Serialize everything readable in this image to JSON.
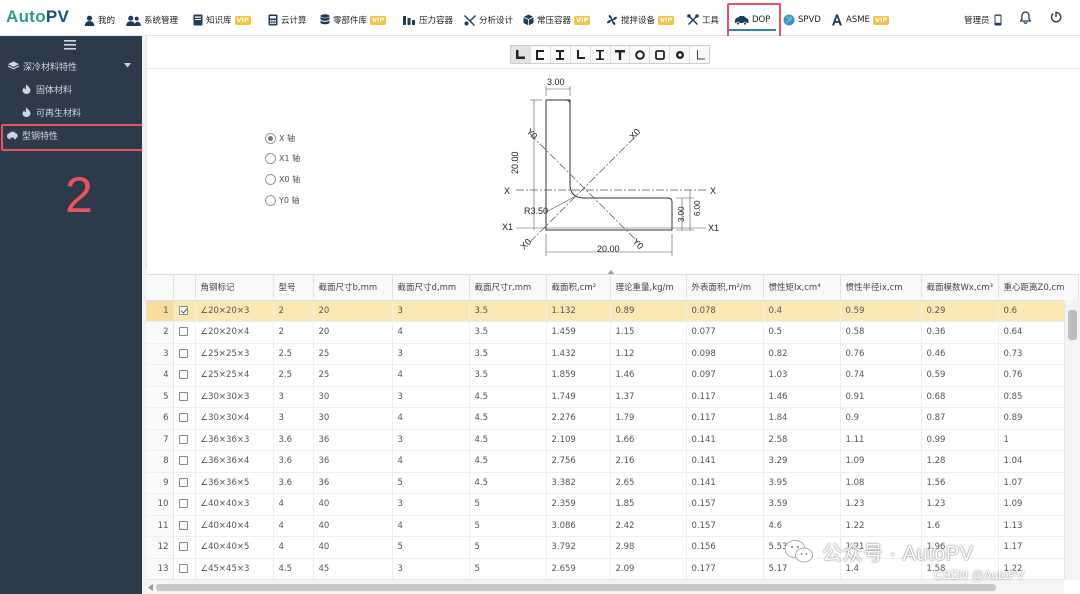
{
  "app": {
    "logo_a": "Auto",
    "logo_b": "PV"
  },
  "nav": [
    {
      "label": "我的",
      "icon": "user-icon",
      "vip": ""
    },
    {
      "label": "系统管理",
      "icon": "users-icon",
      "vip": ""
    },
    {
      "label": "知识库",
      "icon": "book-icon",
      "vip": "VIP"
    },
    {
      "label": "云计算",
      "icon": "calculator-icon",
      "vip": ""
    },
    {
      "label": "零部件库",
      "icon": "database-icon",
      "vip": "VIP"
    },
    {
      "label": "压力容器",
      "icon": "vessel-icon",
      "vip": ""
    },
    {
      "label": "分析设计",
      "icon": "wrench-screwdriver-icon",
      "vip": ""
    },
    {
      "label": "常压容器",
      "icon": "cube-icon",
      "vip": "VIP"
    },
    {
      "label": "搅拌设备",
      "icon": "fan-icon",
      "vip": "VIP"
    },
    {
      "label": "工具",
      "icon": "tools-icon",
      "vip": ""
    },
    {
      "label": "DOP",
      "icon": "car-icon",
      "vip": ""
    },
    {
      "label": "SPVD",
      "icon": "globe-icon",
      "vip": ""
    },
    {
      "label": "ASME",
      "icon": "letter-a-icon",
      "vip": "VIP"
    }
  ],
  "user": {
    "label": "管理员"
  },
  "sidebar": {
    "group": "深冷材料特性",
    "items": [
      "固体材料",
      "可再生材料"
    ],
    "section": "型钢特性"
  },
  "annotations": {
    "one": "1",
    "two": "2"
  },
  "toolbar": {
    "shapes": [
      "L",
      "C",
      "I",
      "L",
      "I",
      "T",
      "O",
      "O",
      "O",
      "L"
    ]
  },
  "axis_options": [
    "X 轴",
    "X1 轴",
    "X0 轴",
    "Y0 轴"
  ],
  "drawing": {
    "dim_t": "3.00",
    "dim_h": "20.00",
    "dim_r": "R3.50",
    "dim_b": "20.00",
    "dim_t2": "3.00",
    "dim_z": "6.00",
    "x": "X",
    "x1": "X1",
    "x0": "X0",
    "y0": "Y0"
  },
  "table": {
    "headers": [
      "角钢标记",
      "型号",
      "截面尺寸b,mm",
      "截面尺寸d,mm",
      "截面尺寸r,mm",
      "截面积,cm²",
      "理论重量,kg/m",
      "外表面积,m²/m",
      "惯性矩Ix,cm⁴",
      "惯性半径ix,cm",
      "截面模数Wx,cm³",
      "重心距离Z0,cm"
    ],
    "rows": [
      [
        "∠20×20×3",
        "2",
        "20",
        "3",
        "3.5",
        "1.132",
        "0.89",
        "0.078",
        "0.4",
        "0.59",
        "0.29",
        "0.6"
      ],
      [
        "∠20×20×4",
        "2",
        "20",
        "4",
        "3.5",
        "1.459",
        "1.15",
        "0.077",
        "0.5",
        "0.58",
        "0.36",
        "0.64"
      ],
      [
        "∠25×25×3",
        "2.5",
        "25",
        "3",
        "3.5",
        "1.432",
        "1.12",
        "0.098",
        "0.82",
        "0.76",
        "0.46",
        "0.73"
      ],
      [
        "∠25×25×4",
        "2.5",
        "25",
        "4",
        "3.5",
        "1.859",
        "1.46",
        "0.097",
        "1.03",
        "0.74",
        "0.59",
        "0.76"
      ],
      [
        "∠30×30×3",
        "3",
        "30",
        "3",
        "4.5",
        "1.749",
        "1.37",
        "0.117",
        "1.46",
        "0.91",
        "0.68",
        "0.85"
      ],
      [
        "∠30×30×4",
        "3",
        "30",
        "4",
        "4.5",
        "2.276",
        "1.79",
        "0.117",
        "1.84",
        "0.9",
        "0.87",
        "0.89"
      ],
      [
        "∠36×36×3",
        "3.6",
        "36",
        "3",
        "4.5",
        "2.109",
        "1.66",
        "0.141",
        "2.58",
        "1.11",
        "0.99",
        "1"
      ],
      [
        "∠36×36×4",
        "3.6",
        "36",
        "4",
        "4.5",
        "2.756",
        "2.16",
        "0.141",
        "3.29",
        "1.09",
        "1.28",
        "1.04"
      ],
      [
        "∠36×36×5",
        "3.6",
        "36",
        "5",
        "4.5",
        "3.382",
        "2.65",
        "0.141",
        "3.95",
        "1.08",
        "1.56",
        "1.07"
      ],
      [
        "∠40×40×3",
        "4",
        "40",
        "3",
        "5",
        "2.359",
        "1.85",
        "0.157",
        "3.59",
        "1.23",
        "1.23",
        "1.09"
      ],
      [
        "∠40×40×4",
        "4",
        "40",
        "4",
        "5",
        "3.086",
        "2.42",
        "0.157",
        "4.6",
        "1.22",
        "1.6",
        "1.13"
      ],
      [
        "∠40×40×5",
        "4",
        "40",
        "5",
        "5",
        "3.792",
        "2.98",
        "0.156",
        "5.53",
        "1.21",
        "1.96",
        "1.17"
      ],
      [
        "∠45×45×3",
        "4.5",
        "45",
        "3",
        "5",
        "2.659",
        "2.09",
        "0.177",
        "5.17",
        "1.4",
        "1.58",
        "1.22"
      ]
    ]
  },
  "watermark": {
    "text": "公众号 · AutoPV",
    "csdn": "CSDN @AutoPV"
  },
  "colors": {
    "accent": "#2c7fb8",
    "sidebar": "#2d3a4b",
    "highlight": "#fbe8b5",
    "annotation": "#e8545d"
  }
}
